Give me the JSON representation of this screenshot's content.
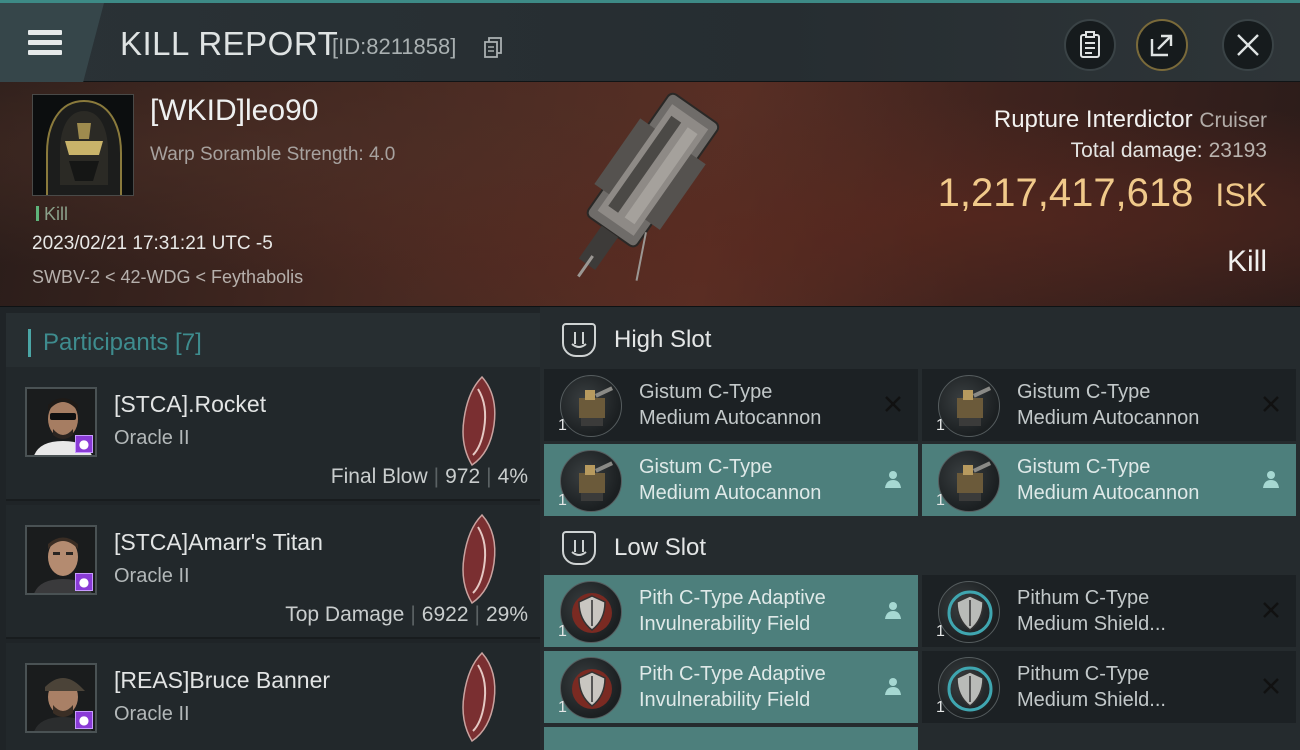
{
  "title_bar": {
    "title": "KILL REPORT",
    "id_text": "[ID:8211858]",
    "buttons": [
      "menu-icon",
      "clipboard-icon",
      "share-icon",
      "close-icon"
    ]
  },
  "victim": {
    "name": "[WKID]leo90",
    "warp_scramble": "Warp Soramble Strength: 4.0",
    "tag": "Kill",
    "datetime": "2023/02/21 17:31:21 UTC -5",
    "location": "SWBV-2 < 42-WDG < Feythabolis",
    "ship_name": "Rupture Interdictor",
    "ship_class": "Cruiser",
    "total_damage_label": "Total damage:",
    "total_damage_value": "23193",
    "isk_value": "1,217,417,618",
    "isk_unit": "ISK",
    "result": "Kill"
  },
  "participants": {
    "header": "Participants [7]",
    "rows": [
      {
        "name": "[STCA].Rocket",
        "ship": "Oracle II",
        "role": "Final Blow",
        "damage": "972",
        "percent": "4%"
      },
      {
        "name": "[STCA]Amarr's Titan",
        "ship": "Oracle II",
        "role": "Top Damage",
        "damage": "6922",
        "percent": "29%"
      },
      {
        "name": "[REAS]Bruce Banner",
        "ship": "Oracle II"
      }
    ]
  },
  "fitting": {
    "high_slot_label": "High Slot",
    "low_slot_label": "Low Slot",
    "high": [
      {
        "qty": "1",
        "line1": "Gistum C-Type",
        "line2": "Medium Autocannon",
        "state": "destroyed",
        "state_icon": "x-icon"
      },
      {
        "qty": "1",
        "line1": "Gistum C-Type",
        "line2": "Medium Autocannon",
        "state": "destroyed",
        "state_icon": "x-icon"
      },
      {
        "qty": "1",
        "line1": "Gistum C-Type",
        "line2": "Medium Autocannon",
        "state": "dropped",
        "state_icon": "person-icon"
      },
      {
        "qty": "1",
        "line1": "Gistum C-Type",
        "line2": "Medium Autocannon",
        "state": "dropped",
        "state_icon": "person-icon"
      }
    ],
    "low": [
      {
        "qty": "1",
        "line1": "Pith C-Type Adaptive",
        "line2": "Invulnerability Field",
        "state": "dropped",
        "state_icon": "person-icon"
      },
      {
        "qty": "1",
        "line1": "Pithum C-Type",
        "line2": "Medium Shield...",
        "state": "destroyed",
        "state_icon": "x-icon"
      },
      {
        "qty": "1",
        "line1": "Pith C-Type Adaptive",
        "line2": "Invulnerability Field",
        "state": "dropped",
        "state_icon": "person-icon"
      },
      {
        "qty": "1",
        "line1": "Pithum C-Type",
        "line2": "Medium Shield...",
        "state": "destroyed",
        "state_icon": "x-icon"
      }
    ]
  },
  "colors": {
    "accent_teal": "#3e8c8e",
    "isk_gold": "#f0c98a",
    "active_module": "#4d7f7c",
    "badge_purple": "#8a3bd6"
  }
}
